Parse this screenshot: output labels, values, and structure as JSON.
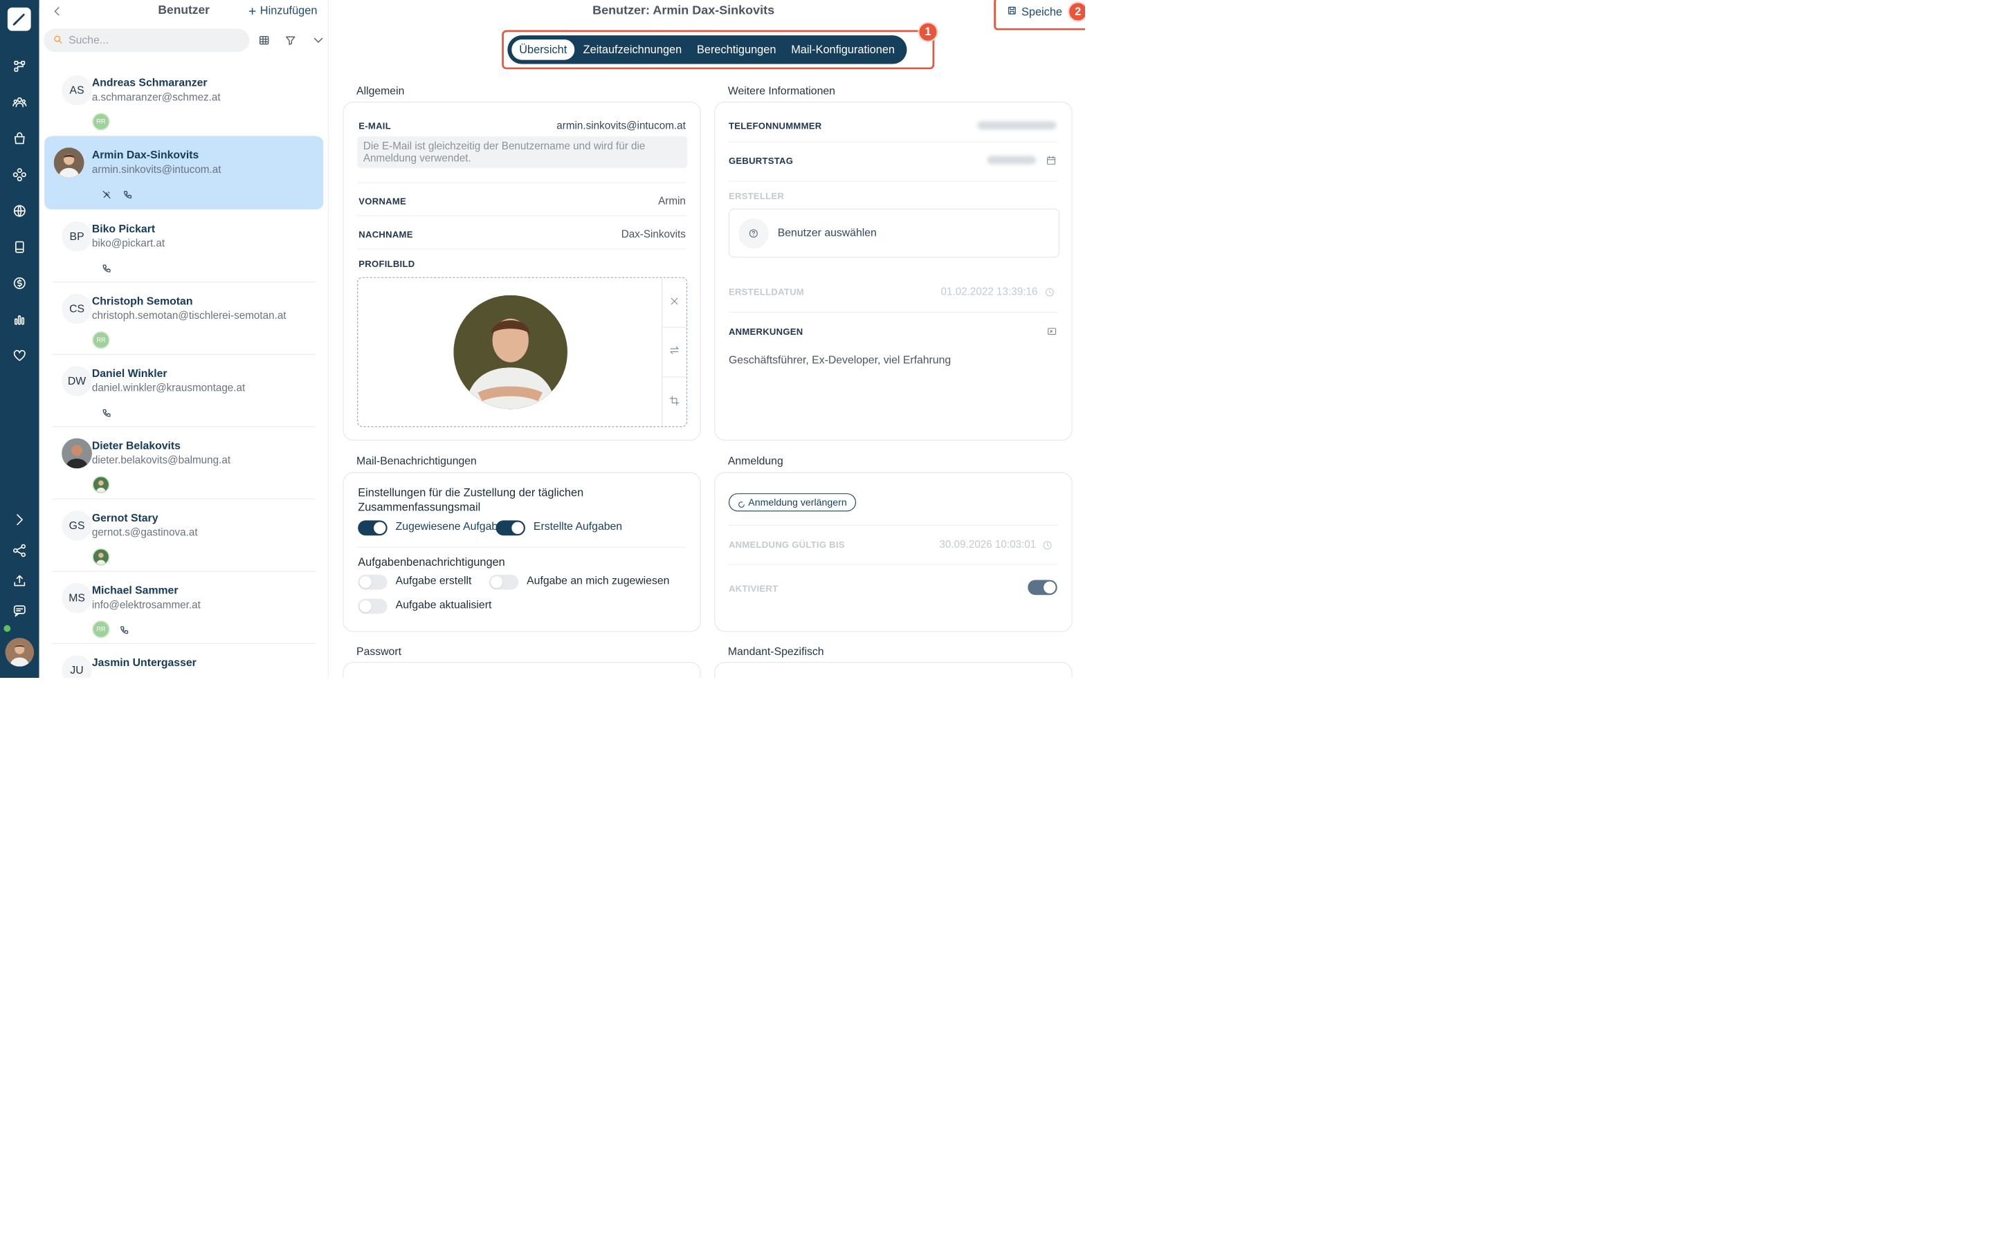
{
  "list": {
    "title": "Benutzer",
    "add_label": "Hinzufügen",
    "search_placeholder": "Suche...",
    "users": [
      {
        "initials": "AS",
        "name": "Andreas Schmaranzer",
        "email": "a.schmaranzer@schmez.at",
        "badge": "RR"
      },
      {
        "initials": "",
        "name": "Armin Dax-Sinkovits",
        "email": "armin.sinkovits@intucom.at",
        "badge": ""
      },
      {
        "initials": "BP",
        "name": "Biko Pickart",
        "email": "biko@pickart.at",
        "badge": ""
      },
      {
        "initials": "CS",
        "name": "Christoph Semotan",
        "email": "christoph.semotan@tischlerei-semotan.at",
        "badge": "RR"
      },
      {
        "initials": "DW",
        "name": "Daniel Winkler",
        "email": "daniel.winkler@krausmontage.at",
        "badge": ""
      },
      {
        "initials": "",
        "name": "Dieter Belakovits",
        "email": "dieter.belakovits@balmung.at",
        "badge": ""
      },
      {
        "initials": "GS",
        "name": "Gernot Stary",
        "email": "gernot.s@gastinova.at",
        "badge": ""
      },
      {
        "initials": "MS",
        "name": "Michael Sammer",
        "email": "info@elektrosammer.at",
        "badge": "RR"
      },
      {
        "initials": "JU",
        "name": "Jasmin Untergasser",
        "email": "",
        "badge": ""
      }
    ]
  },
  "detail": {
    "title": "Benutzer: Armin Dax-Sinkovits",
    "save_label": "Speiche",
    "markers": [
      "1",
      "2"
    ],
    "tabs": [
      "Übersicht",
      "Zeitaufzeichnungen",
      "Berechtigungen",
      "Mail-Konfigurationen"
    ],
    "general": {
      "section_title": "Allgemein",
      "email_label": "E-MAIL",
      "email_value": "armin.sinkovits@intucom.at",
      "email_hint": "Die E-Mail ist gleichzeitig der Benutzername und wird für die Anmeldung verwendet.",
      "firstname_label": "VORNAME",
      "firstname_value": "Armin",
      "lastname_label": "NACHNAME",
      "lastname_value": "Dax-Sinkovits",
      "profile_label": "PROFILBILD"
    },
    "more": {
      "section_title": "Weitere Informationen",
      "phone_label": "TELEFONNUMMMER",
      "birthday_label": "GEBURTSTAG",
      "creator_label": "ERSTELLER",
      "creator_select": "Benutzer auswählen",
      "created_label": "ERSTELLDATUM",
      "created_value": "01.02.2022 13:39:16",
      "notes_label": "ANMERKUNGEN",
      "notes_value": "Geschäftsführer, Ex-Developer, viel Erfahrung"
    },
    "mail": {
      "section_title": "Mail-Benachrichtigungen",
      "daily_heading": "Einstellungen für die Zustellung der täglichen Zusammenfassungsmail",
      "assigned_tasks": "Zugewiesene Aufgaben",
      "created_tasks": "Erstellte Aufgaben",
      "task_heading": "Aufgabenbenachrichtigungen",
      "task_created": "Aufgabe erstellt",
      "task_assigned": "Aufgabe an mich zugewiesen",
      "task_updated": "Aufgabe aktualisiert"
    },
    "login": {
      "section_title": "Anmeldung",
      "extend_label": "Anmeldung verlängern",
      "valid_label": "ANMELDUNG GÜLTIG BIS",
      "valid_value": "30.09.2026 10:03:01",
      "active_label": "AKTIVIERT"
    },
    "password": {
      "section_title": "Passwort"
    },
    "tenant": {
      "section_title": "Mandant-Spezifisch"
    }
  },
  "colors": {
    "primary": "#163f5c",
    "accent": "#e8553b",
    "selected": "#c7e2fb"
  }
}
